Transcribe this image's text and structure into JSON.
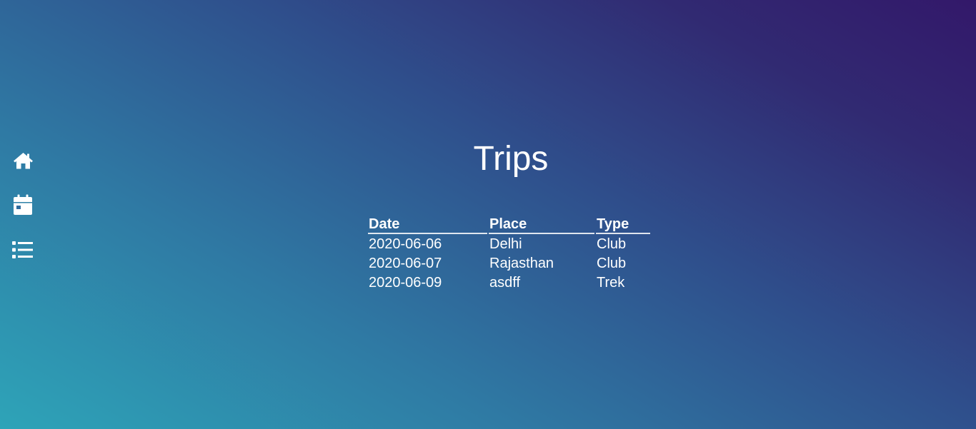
{
  "nav": {
    "items": [
      {
        "icon": "home-icon",
        "name": "home"
      },
      {
        "icon": "calendar-icon",
        "name": "calendar"
      },
      {
        "icon": "list-icon",
        "name": "list"
      }
    ]
  },
  "page": {
    "title": "Trips"
  },
  "table": {
    "columns": [
      "Date",
      "Place",
      "Type"
    ],
    "rows": [
      [
        "2020-06-06",
        "Delhi",
        "Club"
      ],
      [
        "2020-06-07",
        "Rajasthan",
        "Club"
      ],
      [
        "2020-06-09",
        "asdff",
        "Trek"
      ]
    ]
  },
  "colors": {
    "text": "#ffffff",
    "gradient_start": "#2ea4b8",
    "gradient_end": "#33186a"
  }
}
